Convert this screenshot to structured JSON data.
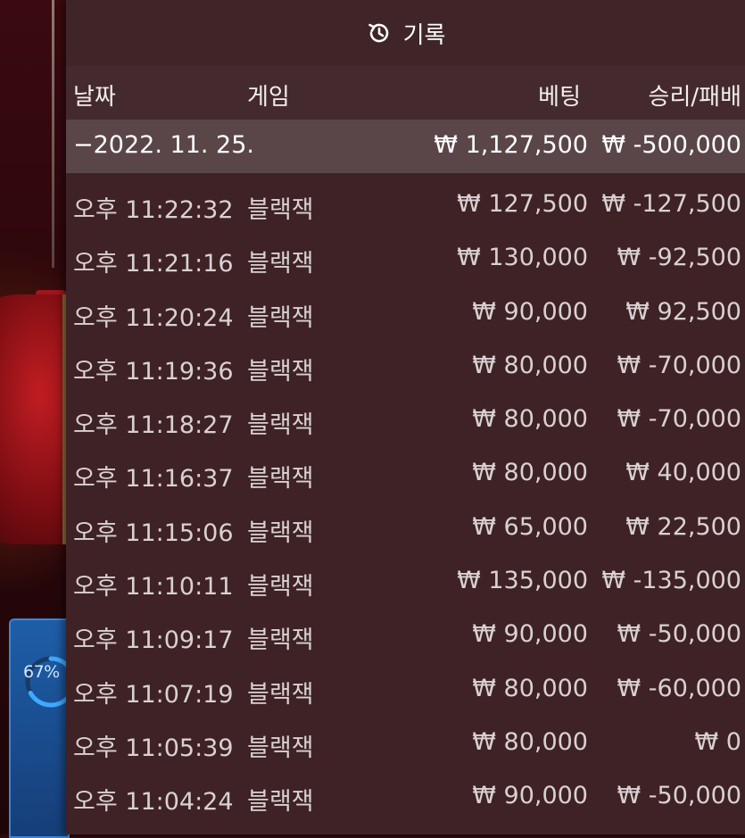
{
  "header": {
    "title": "기록",
    "icon": "history-icon"
  },
  "columns": {
    "date": "날짜",
    "game": "게임",
    "bet": "베팅",
    "result": "승리/패배"
  },
  "date_group": {
    "label": "−2022. 11. 25.",
    "bet_total": "₩ 1,127,500",
    "result_total": "₩ -500,000"
  },
  "rows": [
    {
      "time": "오후 11:22:32",
      "game": "블랙잭",
      "bet": "₩ 127,500",
      "result": "₩ -127,500"
    },
    {
      "time": "오후 11:21:16",
      "game": "블랙잭",
      "bet": "₩ 130,000",
      "result": "₩ -92,500"
    },
    {
      "time": "오후 11:20:24",
      "game": "블랙잭",
      "bet": "₩ 90,000",
      "result": "₩ 92,500"
    },
    {
      "time": "오후 11:19:36",
      "game": "블랙잭",
      "bet": "₩ 80,000",
      "result": "₩ -70,000"
    },
    {
      "time": "오후 11:18:27",
      "game": "블랙잭",
      "bet": "₩ 80,000",
      "result": "₩ -70,000"
    },
    {
      "time": "오후 11:16:37",
      "game": "블랙잭",
      "bet": "₩ 80,000",
      "result": "₩ 40,000"
    },
    {
      "time": "오후 11:15:06",
      "game": "블랙잭",
      "bet": "₩ 65,000",
      "result": "₩ 22,500"
    },
    {
      "time": "오후 11:10:11",
      "game": "블랙잭",
      "bet": "₩ 135,000",
      "result": "₩ -135,000"
    },
    {
      "time": "오후 11:09:17",
      "game": "블랙잭",
      "bet": "₩ 90,000",
      "result": "₩ -50,000"
    },
    {
      "time": "오후 11:07:19",
      "game": "블랙잭",
      "bet": "₩ 80,000",
      "result": "₩ -60,000"
    },
    {
      "time": "오후 11:05:39",
      "game": "블랙잭",
      "bet": "₩ 80,000",
      "result": "₩ 0"
    },
    {
      "time": "오후 11:04:24",
      "game": "블랙잭",
      "bet": "₩ 90,000",
      "result": "₩ -50,000"
    }
  ],
  "background": {
    "progress_label": "67%",
    "progress_value": 0.67
  },
  "colors": {
    "panel": "#3e2226",
    "date_row": "#5a4649",
    "progress_blue": "#1e5ea8",
    "progress_ring": "#3fa9ff"
  }
}
